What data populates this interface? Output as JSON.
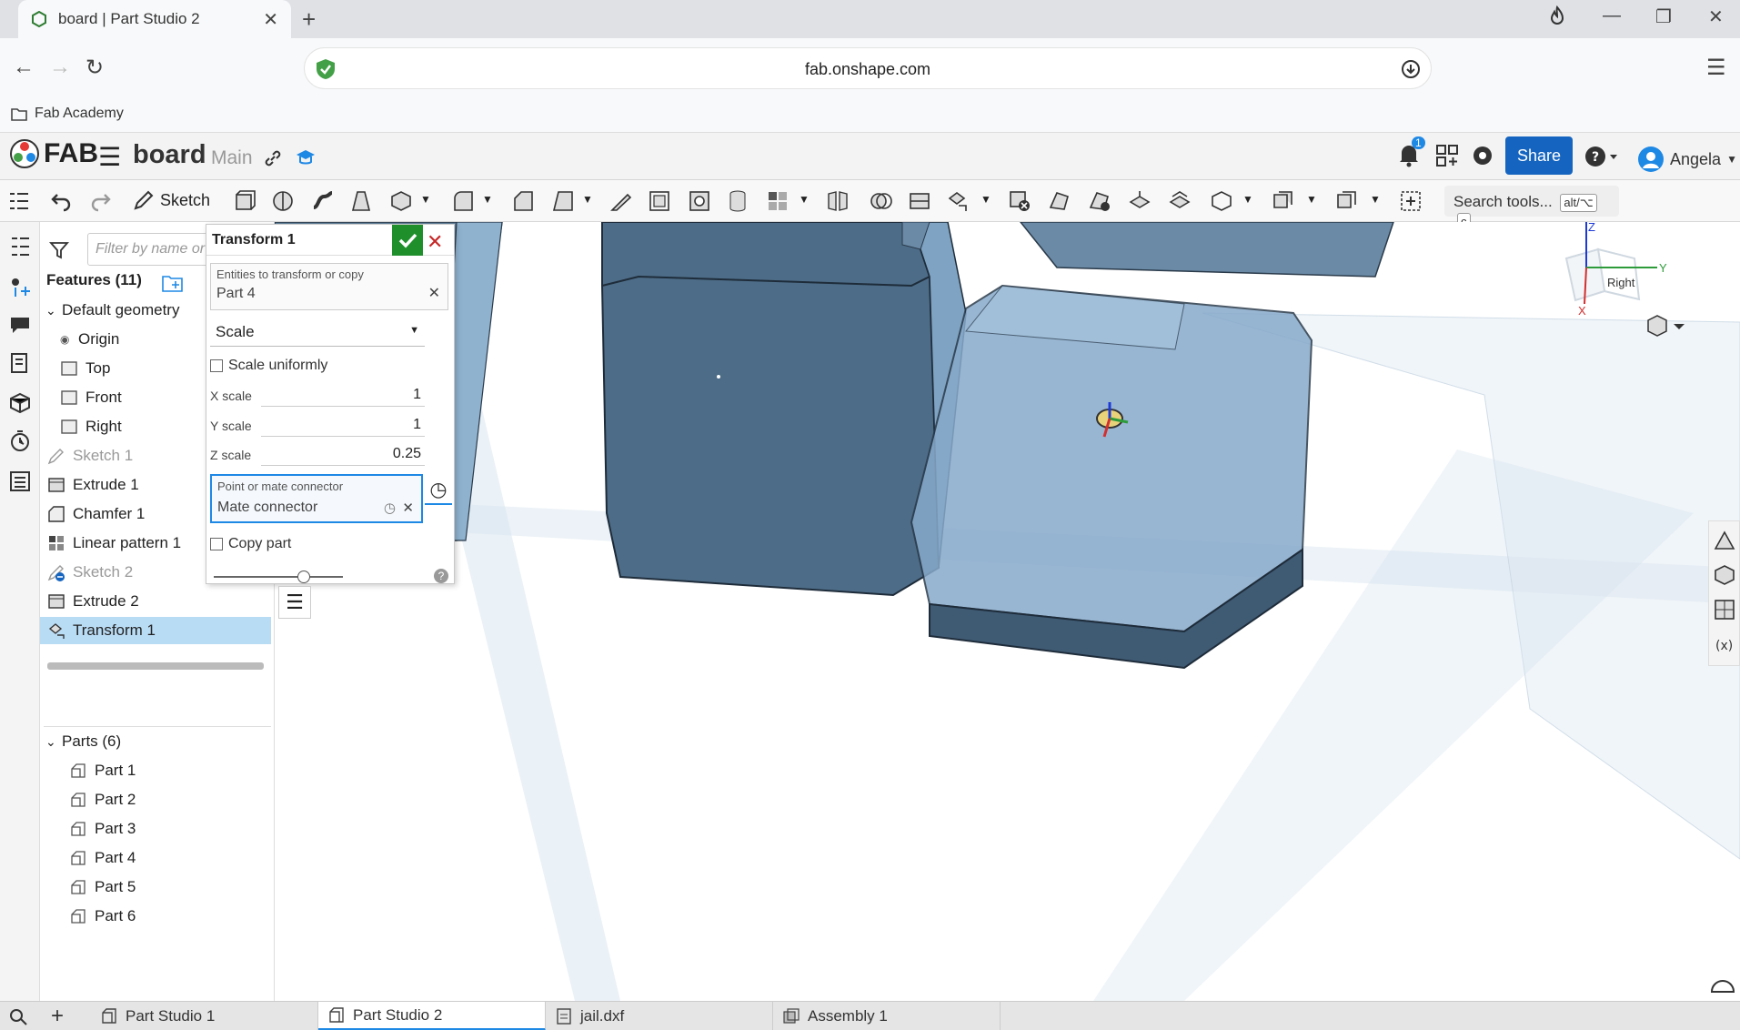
{
  "browser": {
    "tab_title": "board | Part Studio 2",
    "url": "fab.onshape.com",
    "bookmark": "Fab Academy"
  },
  "app": {
    "logo_text": "FAB",
    "doc_name": "board",
    "branch": "Main",
    "share_label": "Share",
    "user_name": "Angela",
    "notification_count": "1"
  },
  "toolbar": {
    "sketch_label": "Sketch",
    "search_placeholder": "Search tools...",
    "search_shortcut_1": "alt/⌥",
    "search_shortcut_2": "c"
  },
  "tree": {
    "filter_placeholder": "Filter by name or",
    "features_heading": "Features (11)",
    "items": [
      {
        "label": "Default geometry",
        "kind": "group"
      },
      {
        "label": "Origin",
        "kind": "origin"
      },
      {
        "label": "Top",
        "kind": "plane"
      },
      {
        "label": "Front",
        "kind": "plane"
      },
      {
        "label": "Right",
        "kind": "plane"
      },
      {
        "label": "Sketch 1",
        "kind": "sketch"
      },
      {
        "label": "Extrude 1",
        "kind": "feature"
      },
      {
        "label": "Chamfer 1",
        "kind": "feature"
      },
      {
        "label": "Linear pattern 1",
        "kind": "feature"
      },
      {
        "label": "Sketch 2",
        "kind": "sketch"
      },
      {
        "label": "Extrude 2",
        "kind": "feature"
      },
      {
        "label": "Transform 1",
        "kind": "feature"
      }
    ],
    "parts_heading": "Parts (6)",
    "parts": [
      "Part 1",
      "Part 2",
      "Part 3",
      "Part 4",
      "Part 5",
      "Part 6"
    ]
  },
  "dialog": {
    "title": "Transform 1",
    "entities_label": "Entities to transform or copy",
    "entities_value": "Part 4",
    "type": "Scale",
    "scale_uniformly": "Scale uniformly",
    "x_label": "X scale",
    "x_value": "1",
    "y_label": "Y scale",
    "y_value": "1",
    "z_label": "Z scale",
    "z_value": "0.25",
    "mate_label": "Point or mate connector",
    "mate_value": "Mate connector",
    "copy_part": "Copy part",
    "slider_position": 0.7
  },
  "viewcube": {
    "face_label": "Right",
    "x_axis": "X",
    "y_axis": "Y",
    "z_axis": "Z"
  },
  "bottom_tabs": [
    "Part Studio 1",
    "Part Studio 2",
    "jail.dxf",
    "Assembly 1"
  ],
  "colors": {
    "accent": "#1e88e5",
    "share": "#1565c0",
    "ok": "#1f8f2c",
    "cancel": "#c62828",
    "selection": "#b9dcf5",
    "part_fill": "#6f93b4"
  }
}
